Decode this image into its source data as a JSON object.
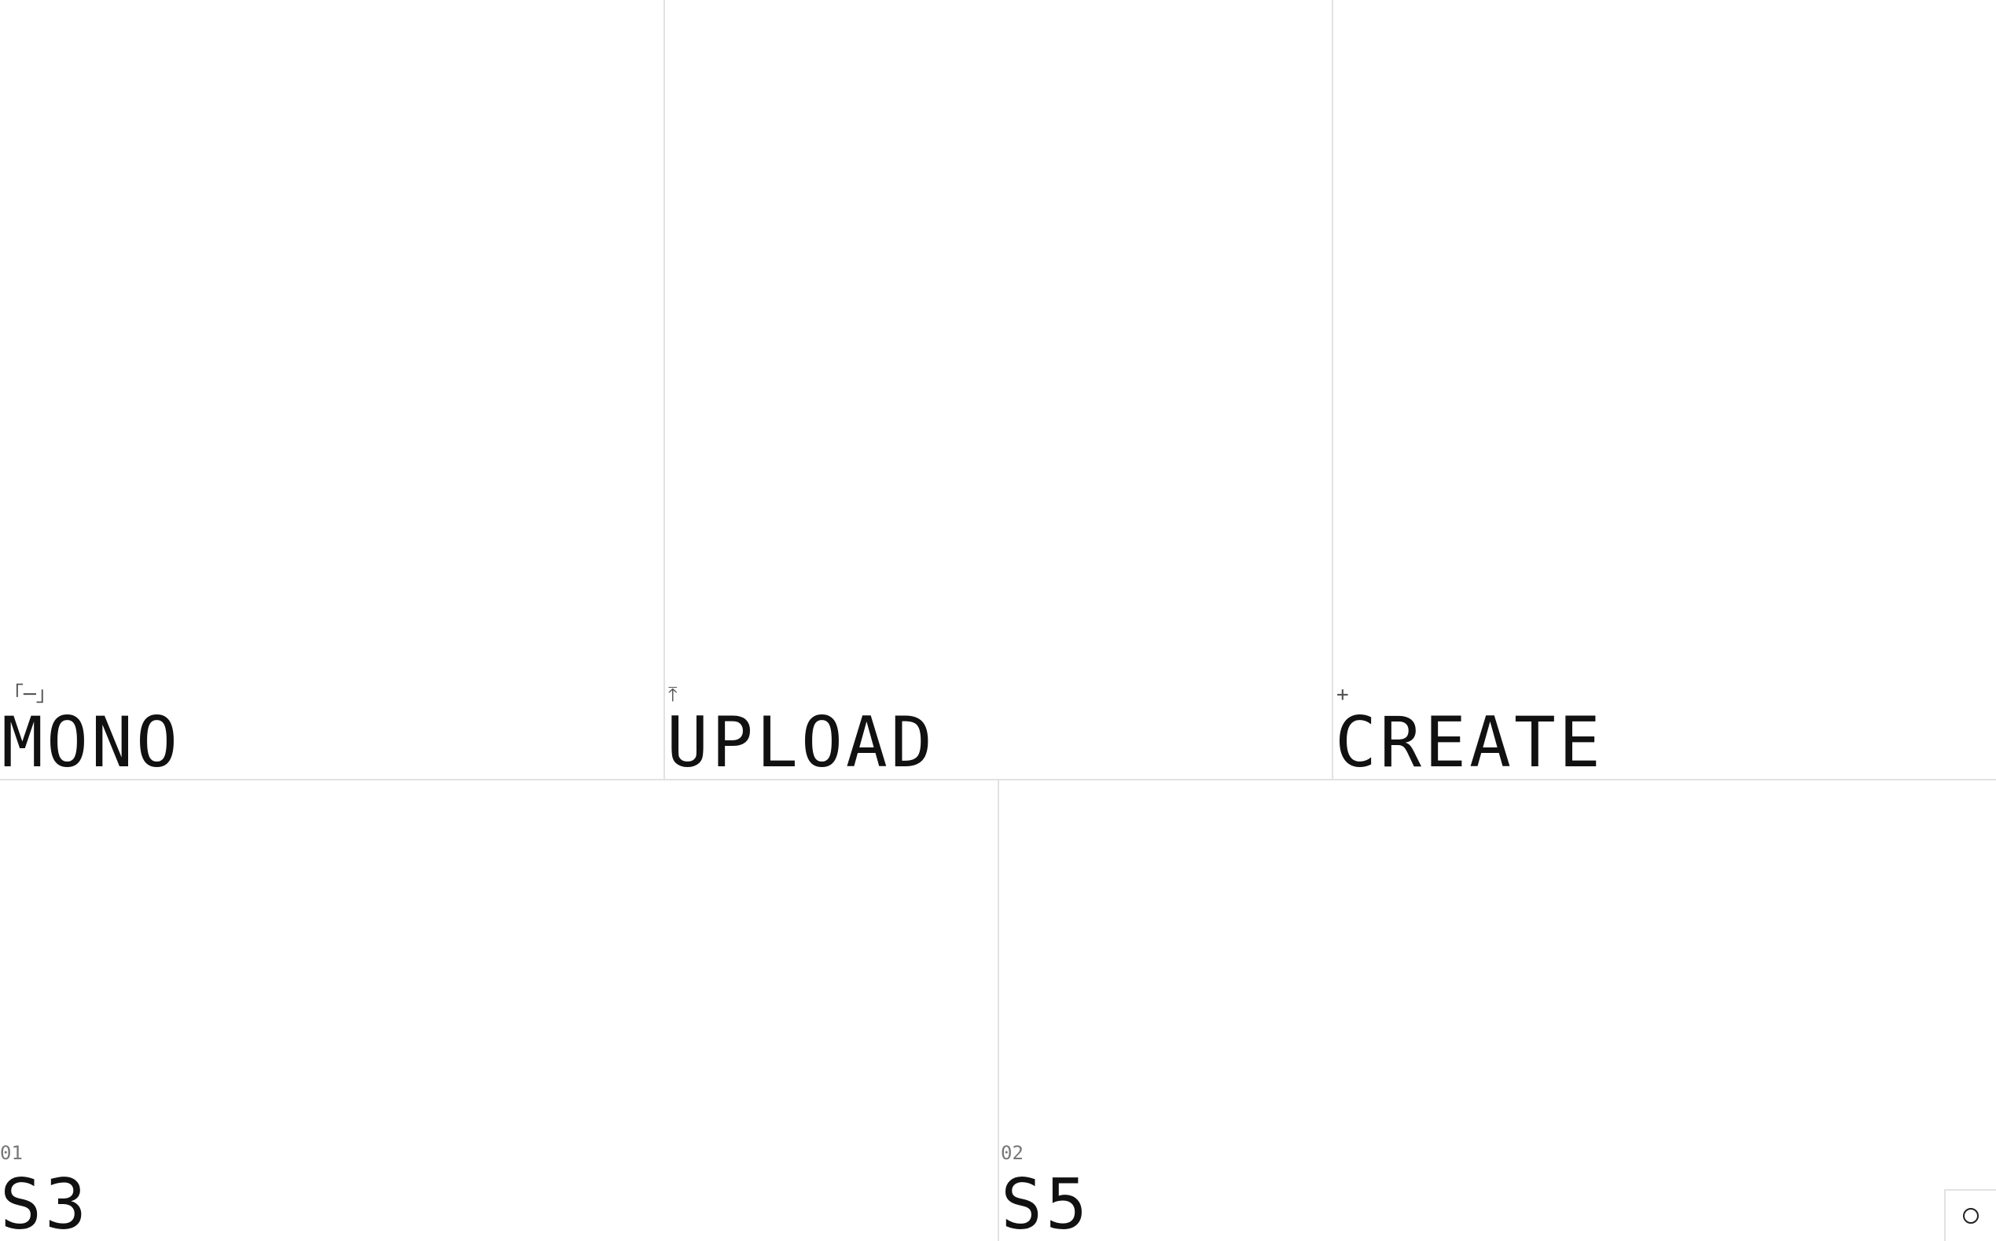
{
  "top_tiles": [
    {
      "icon": "「─」",
      "icon_name": "mono-bracket-icon",
      "label": "MONO"
    },
    {
      "icon": "⤒",
      "icon_name": "upload-icon",
      "label": "UPLOAD"
    },
    {
      "icon": "+",
      "icon_name": "plus-icon",
      "label": "CREATE"
    }
  ],
  "bottom_tiles": [
    {
      "number": "01",
      "label": "S3"
    },
    {
      "number": "02",
      "label": "S5"
    }
  ],
  "mode_toggle": {
    "icon_name": "circle-icon"
  },
  "colors": {
    "background": "#ffffff",
    "text": "#111111",
    "muted": "#777777",
    "divider": "#e2e2e2"
  }
}
